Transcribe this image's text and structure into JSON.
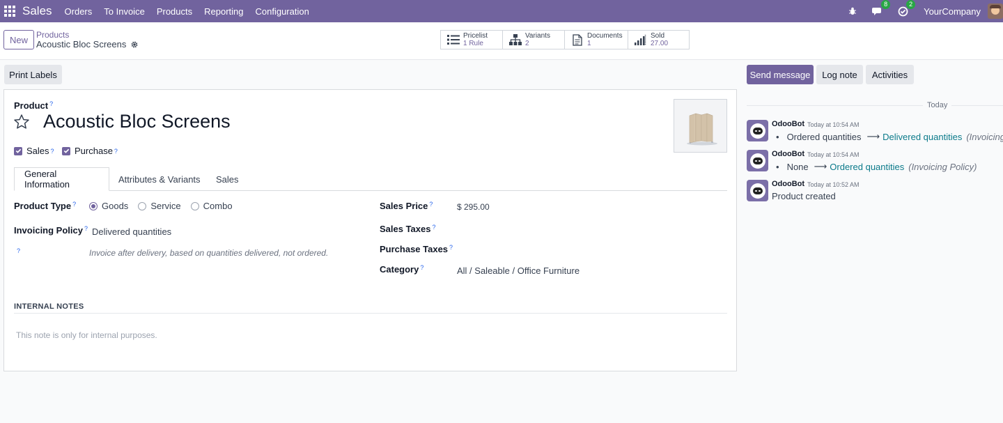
{
  "navbar": {
    "app_name": "Sales",
    "menu": [
      "Orders",
      "To Invoice",
      "Products",
      "Reporting",
      "Configuration"
    ],
    "messages_badge": "8",
    "activities_badge": "2",
    "company": "YourCompany",
    "color": "#71639e"
  },
  "control": {
    "new_label": "New",
    "breadcrumb_parent": "Products",
    "breadcrumb_current": "Acoustic Bloc Screens",
    "smart_buttons": [
      {
        "label": "Pricelist",
        "value": "1  Rule",
        "icon": "list-icon"
      },
      {
        "label": "Variants",
        "value": "2",
        "icon": "sitemap-icon"
      },
      {
        "label": "Documents",
        "value": "1",
        "icon": "document-icon"
      },
      {
        "label": "Sold",
        "value": "27.00",
        "icon": "signal-icon"
      }
    ]
  },
  "form": {
    "print_labels": "Print Labels",
    "product_label": "Product",
    "product_name": "Acoustic Bloc Screens",
    "sales_checkbox": "Sales",
    "purchase_checkbox": "Purchase",
    "help_mark": "?",
    "tabs": [
      "General Information",
      "Attributes & Variants",
      "Sales"
    ],
    "product_type_label": "Product Type",
    "product_type_options": [
      "Goods",
      "Service",
      "Combo"
    ],
    "product_type_selected": "Goods",
    "invoicing_policy_label": "Invoicing Policy",
    "invoicing_policy_value": "Delivered quantities",
    "invoicing_help": "Invoice after delivery, based on quantities delivered, not ordered.",
    "sales_price_label": "Sales Price",
    "sales_price_value": "$ 295.00",
    "sales_taxes_label": "Sales Taxes",
    "purchase_taxes_label": "Purchase Taxes",
    "category_label": "Category",
    "category_value": "All / Saleable / Office Furniture",
    "notes_heading": "INTERNAL NOTES",
    "notes_placeholder": "This note is only for internal purposes."
  },
  "chatter": {
    "send_message": "Send message",
    "log_note": "Log note",
    "activities": "Activities",
    "today": "Today",
    "messages": [
      {
        "author": "OdooBot",
        "time": "Today at 10:54 AM",
        "bullet": "•",
        "old": "Ordered quantities",
        "new": "Delivered quantities",
        "field": "(Invoicing P"
      },
      {
        "author": "OdooBot",
        "time": "Today at 10:54 AM",
        "bullet": "•",
        "old": "None",
        "new": "Ordered quantities",
        "field": "(Invoicing Policy)"
      },
      {
        "author": "OdooBot",
        "time": "Today at 10:52 AM",
        "text": "Product created"
      }
    ]
  }
}
